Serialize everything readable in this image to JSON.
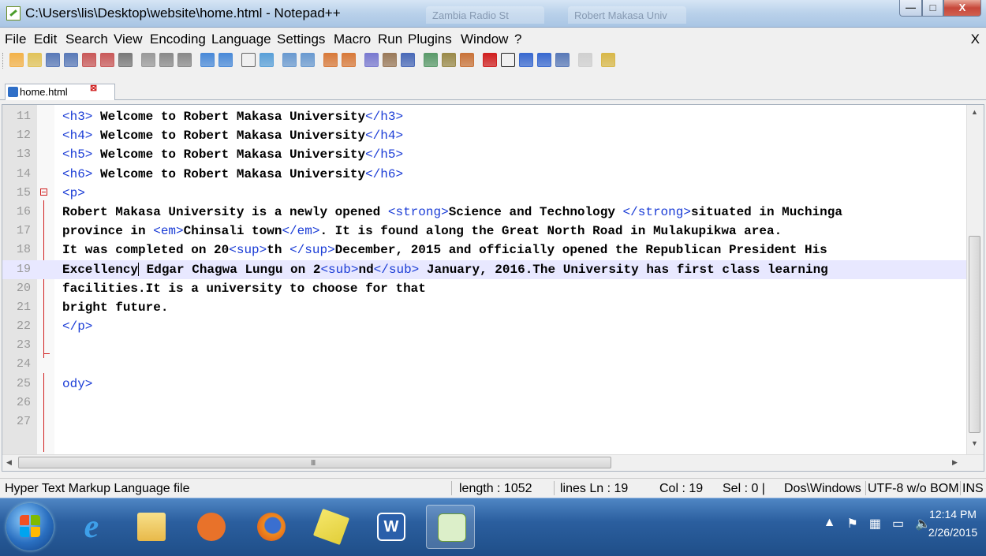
{
  "window": {
    "title": "C:\\Users\\lis\\Desktop\\website\\home.html - Notepad++",
    "background_tabs": [
      "Zambia Radio St",
      "Robert Makasa Univ"
    ],
    "buttons": {
      "minimize": "—",
      "maximize": "□",
      "close": "X"
    }
  },
  "menu": {
    "items": [
      "File",
      "Edit",
      "Search",
      "View",
      "Encoding",
      "Language",
      "Settings",
      "Macro",
      "Run",
      "Plugins",
      "Window",
      "?"
    ],
    "close": "X"
  },
  "toolbar": {
    "icons": [
      "new-file-icon",
      "open-file-icon",
      "save-icon",
      "save-all-icon",
      "close-icon",
      "close-all-icon",
      "print-icon",
      "cut-icon",
      "copy-icon",
      "paste-icon",
      "undo-icon",
      "redo-icon",
      "find-icon",
      "replace-icon",
      "zoom-in-icon",
      "zoom-out-icon",
      "sync-vertical-icon",
      "sync-horizontal-icon",
      "word-wrap-icon",
      "show-all-chars-icon",
      "indent-guide-icon",
      "doc-map-icon",
      "function-list-icon",
      "folder-workspace-icon",
      "record-macro-icon",
      "stop-record-icon",
      "play-macro-icon",
      "run-macro-multiple-icon",
      "save-macro-icon",
      "spell-check-icon",
      "extra-icon"
    ]
  },
  "file_tab": {
    "label": "home.html",
    "close": "⊠"
  },
  "editor": {
    "lines": [
      {
        "n": "11",
        "segments": [
          [
            "tag",
            "<h3>"
          ],
          [
            "txt",
            " Welcome to Robert Makasa University"
          ],
          [
            "tag",
            "</h3>"
          ]
        ]
      },
      {
        "n": "12",
        "segments": [
          [
            "tag",
            "<h4>"
          ],
          [
            "txt",
            " Welcome to Robert Makasa University"
          ],
          [
            "tag",
            "</h4>"
          ]
        ]
      },
      {
        "n": "13",
        "segments": [
          [
            "tag",
            "<h5>"
          ],
          [
            "txt",
            " Welcome to Robert Makasa University"
          ],
          [
            "tag",
            "</h5>"
          ]
        ]
      },
      {
        "n": "14",
        "segments": [
          [
            "tag",
            "<h6>"
          ],
          [
            "txt",
            " Welcome to Robert Makasa University"
          ],
          [
            "tag",
            "</h6>"
          ]
        ]
      },
      {
        "n": "15",
        "segments": [
          [
            "tag",
            "<p>"
          ]
        ]
      },
      {
        "n": "16",
        "segments": [
          [
            "txt",
            "Robert Makasa University is a newly opened "
          ],
          [
            "tag",
            "<strong>"
          ],
          [
            "txt",
            "Science and Technology "
          ],
          [
            "tag",
            "</strong>"
          ],
          [
            "txt",
            "situated in Muchinga"
          ]
        ]
      },
      {
        "n": "17",
        "segments": [
          [
            "txt",
            "province in "
          ],
          [
            "tag",
            "<em>"
          ],
          [
            "txt",
            "Chinsali town"
          ],
          [
            "tag",
            "</em>"
          ],
          [
            "txt",
            ". It is found along the Great North Road in Mulakupikwa area."
          ]
        ]
      },
      {
        "n": "18",
        "segments": [
          [
            "txt",
            "It was completed on 20"
          ],
          [
            "tag",
            "<sup>"
          ],
          [
            "txt",
            "th "
          ],
          [
            "tag",
            "</sup>"
          ],
          [
            "txt",
            "December, 2015 and officially opened the Republican President His"
          ]
        ]
      },
      {
        "n": "19",
        "segments": [
          [
            "txt",
            "Excellency"
          ],
          [
            "caret",
            ""
          ],
          [
            "txt",
            " Edgar Chagwa Lungu on 2"
          ],
          [
            "tag",
            "<sub>"
          ],
          [
            "txt",
            "nd"
          ],
          [
            "tag",
            "</sub>"
          ],
          [
            "txt",
            " January, 2016.The University has first class learning"
          ]
        ]
      },
      {
        "n": "20",
        "segments": [
          [
            "txt",
            "facilities.It is a university to choose for that"
          ]
        ]
      },
      {
        "n": "21",
        "segments": [
          [
            "txt",
            "bright future."
          ]
        ]
      },
      {
        "n": "22",
        "segments": [
          [
            "tag",
            "</p>"
          ]
        ]
      },
      {
        "n": "23",
        "segments": []
      },
      {
        "n": "24",
        "segments": []
      },
      {
        "n": "25",
        "segments": [
          [
            "tag",
            "ody>"
          ]
        ]
      },
      {
        "n": "26",
        "segments": []
      },
      {
        "n": "27",
        "segments": []
      }
    ],
    "current_line": "19",
    "scroll": {
      "grip": "III"
    }
  },
  "status": {
    "file_type": "Hyper Text Markup Language file",
    "length": "length : 1052",
    "lines": "lines Ln : 19",
    "col": "Col : 19",
    "sel": "Sel : 0 |",
    "eol": "Dos\\Windows",
    "encoding": "UTF-8 w/o BOM",
    "mode": "INS"
  },
  "taskbar": {
    "apps": [
      "internet-explorer-icon",
      "file-explorer-icon",
      "media-player-icon",
      "firefox-icon",
      "sticky-notes-icon",
      "word-icon",
      "notepadpp-icon"
    ],
    "clock_time": "12:14 PM",
    "clock_date": "2/26/2015"
  },
  "colors": {
    "tag": "#1a3cd6",
    "current_line": "#e8e8ff",
    "taskbar": "#2b5f9f"
  }
}
